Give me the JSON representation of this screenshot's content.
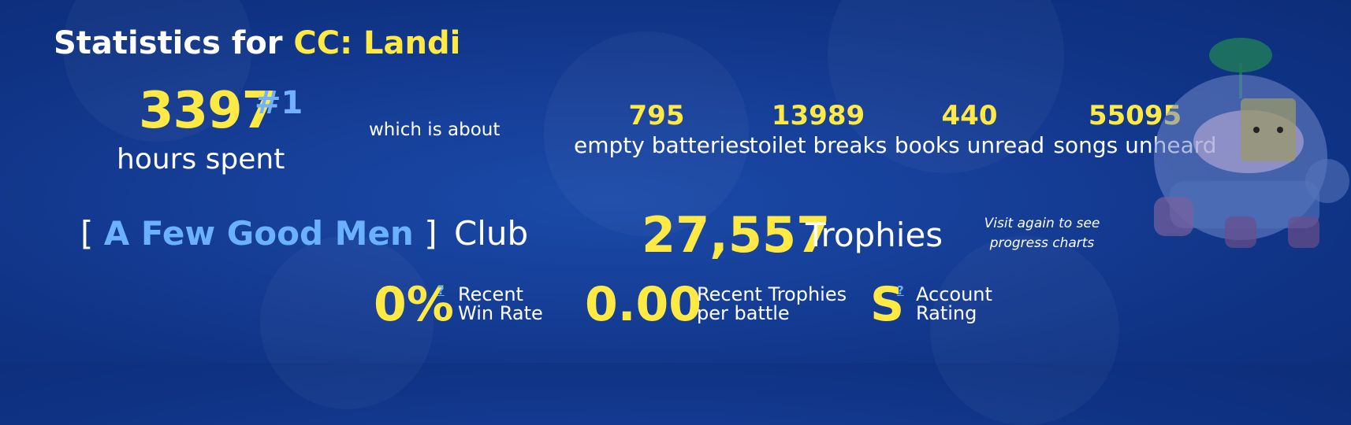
{
  "header": {
    "title_prefix": "Statistics for ",
    "player_name": "CC: Landi"
  },
  "hours": {
    "value": "3397",
    "rank": "#1",
    "label": "hours spent"
  },
  "about_text": "which is about",
  "equivalents": [
    {
      "value": "795",
      "label": "empty batteries"
    },
    {
      "value": "13989",
      "label": "toilet breaks"
    },
    {
      "value": "440",
      "label": "books unread"
    },
    {
      "value": "55095",
      "label": "songs unheard"
    }
  ],
  "club": {
    "open_bracket": "[",
    "name": "A Few Good Men",
    "close_bracket": "]",
    "suffix": "Club"
  },
  "trophies": {
    "value": "27,557",
    "label": "Trophies",
    "note": "Visit again to see progress charts"
  },
  "recent": {
    "win_rate": {
      "value": "0%",
      "help": "?",
      "label_line1": "Recent",
      "label_line2": "Win Rate"
    },
    "trophies_per_battle": {
      "value": "0.00",
      "label_line1": "Recent Trophies",
      "label_line2": "per battle"
    },
    "account_rating": {
      "value": "S",
      "help": "?",
      "label_line1": "Account",
      "label_line2": "Rating"
    }
  },
  "colors": {
    "accent_yellow": "#ffe945",
    "accent_blue": "#6ab1ff",
    "background": "#123a8e"
  },
  "icons": {
    "brawler": "spike-robot-illustration"
  }
}
